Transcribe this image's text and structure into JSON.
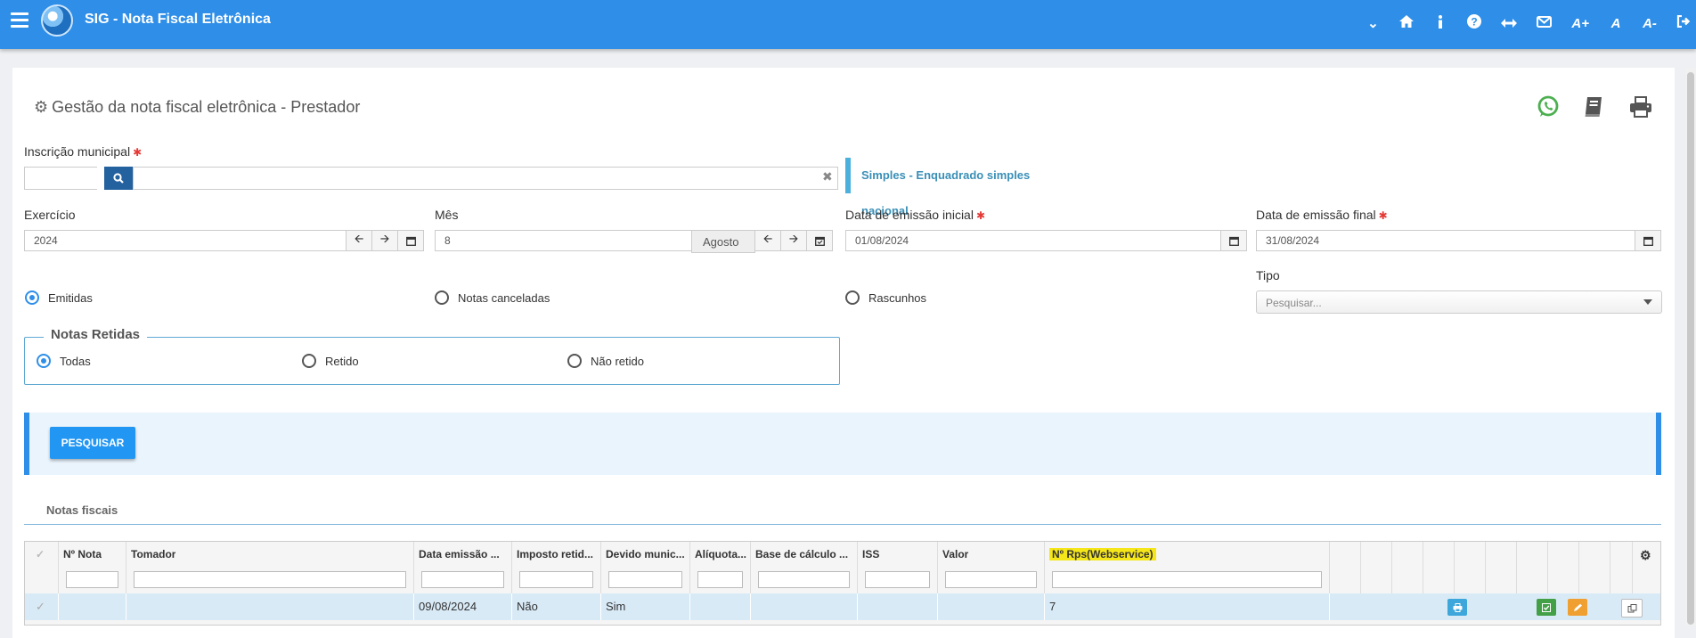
{
  "app": {
    "title": "SIG - Nota Fiscal Eletrônica"
  },
  "topbar": {
    "icons": [
      "chevron-down-icon",
      "home-icon",
      "info-icon",
      "help-icon",
      "expand-width-icon",
      "envelope-icon",
      "font-increase-icon",
      "font-normal-icon",
      "font-decrease-icon",
      "logout-icon"
    ],
    "font_increase": "A+",
    "font_normal": "A",
    "font_decrease": "A-"
  },
  "page": {
    "title": "Gestão da nota fiscal eletrônica - Prestador"
  },
  "form": {
    "inscricao_label": "Inscrição municipal",
    "inscricao_value": "",
    "regime_info": "Simples - Enquadrado simples nacional",
    "exercicio_label": "Exercício",
    "exercicio_value": "2024",
    "mes_label": "Mês",
    "mes_value": "8",
    "mes_name": "Agosto",
    "data_inicial_label": "Data de emissão inicial",
    "data_inicial_value": "01/08/2024",
    "data_final_label": "Data de emissão final",
    "data_final_value": "31/08/2024",
    "status_options": [
      {
        "label": "Emitidas",
        "selected": true
      },
      {
        "label": "Notas canceladas",
        "selected": false
      },
      {
        "label": "Rascunhos",
        "selected": false
      }
    ],
    "tipo_label": "Tipo",
    "tipo_placeholder": "Pesquisar...",
    "retidas_legend": "Notas Retidas",
    "retidas_options": [
      {
        "label": "Todas",
        "selected": true
      },
      {
        "label": "Retido",
        "selected": false
      },
      {
        "label": "Não retido",
        "selected": false
      }
    ],
    "search_button": "PESQUISAR"
  },
  "grid": {
    "section_title": "Notas fiscais",
    "columns": [
      "Nº Nota",
      "Tomador",
      "Data emissão ...",
      "Imposto retid...",
      "Devido munic...",
      "Alíquota...",
      "Base de cálculo ...",
      "ISS",
      "Valor",
      "Nº Rps(Webservice)"
    ],
    "rows": [
      {
        "numero": "",
        "tomador": "",
        "data": "09/08/2024",
        "imposto_retido": "Não",
        "devido_municipio": "Sim",
        "aliquota": "",
        "base_calculo": "",
        "iss": "",
        "valor": "",
        "rps": "7"
      }
    ]
  },
  "colors": {
    "topbar": "#2f8fe8",
    "accent": "#2196f3",
    "highlight": "#f5e61a"
  }
}
